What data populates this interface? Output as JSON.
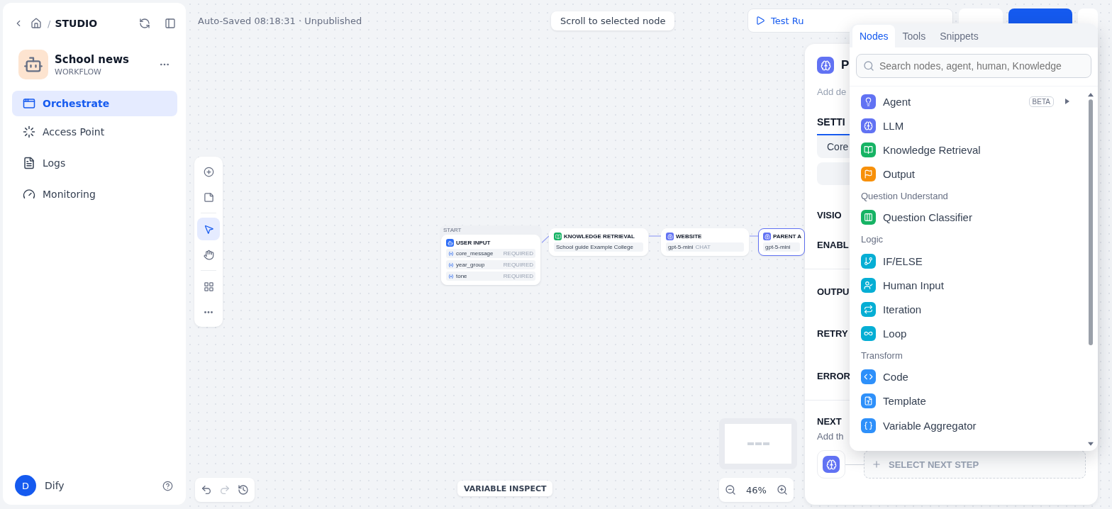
{
  "sidebar": {
    "separator": "/",
    "breadcrumb": "STUDIO",
    "app": {
      "name": "School news",
      "type": "WORKFLOW"
    },
    "nav": [
      {
        "label": "Orchestrate",
        "selected": true
      },
      {
        "label": "Access Point",
        "selected": false
      },
      {
        "label": "Logs",
        "selected": false
      },
      {
        "label": "Monitoring",
        "selected": false
      }
    ],
    "user": {
      "initial": "D",
      "name": "Dify"
    }
  },
  "header": {
    "status": "Auto-Saved 08:18:31 · Unpublished",
    "scroll_hint": "Scroll to selected node",
    "test_run": "Test Ru"
  },
  "canvas": {
    "tools": [
      {
        "selected": false
      },
      {
        "selected": false
      },
      {
        "selected": true
      },
      {
        "selected": false
      },
      {
        "selected": false
      },
      {
        "selected": false
      }
    ],
    "nodes": [
      {
        "kind": "start",
        "label": "START",
        "title": "USER INPUT",
        "variables": [
          {
            "name": "core_message",
            "tag": "REQUIRED"
          },
          {
            "name": "year_group",
            "tag": "REQUIRED"
          },
          {
            "name": "tone",
            "tag": "REQUIRED"
          }
        ]
      },
      {
        "kind": "knowledge",
        "title": "KNOWLEDGE RETRIEVAL",
        "dataset": "School guide Example College"
      },
      {
        "kind": "llm",
        "title": "WEBSITE",
        "model": "gpt-5-mini",
        "tag": "CHAT",
        "selected": false
      },
      {
        "kind": "llm",
        "title": "PARENT A",
        "model": "gpt-5-mini",
        "selected": true
      }
    ],
    "variable_inspect": "VARIABLE INSPECT",
    "zoom": "46%"
  },
  "panel": {
    "title": "P",
    "description": "Add de",
    "tab": "SETTI",
    "chip": "Core",
    "sections": [
      "VISIO",
      "ENABL",
      "OUTPU",
      "RETRY",
      "ERROR"
    ],
    "next_step": {
      "title": "NEXT",
      "hint": "Add th",
      "button": "SELECT NEXT STEP"
    }
  },
  "node_picker": {
    "tabs": [
      {
        "label": "Nodes",
        "selected": true
      },
      {
        "label": "Tools",
        "selected": false
      },
      {
        "label": "Snippets",
        "selected": false
      }
    ],
    "placeholder": "Search nodes, agent, human, Knowledge",
    "items": [
      {
        "kind": "item",
        "label": "Agent",
        "badge": "BETA",
        "color": "#6172f3"
      },
      {
        "kind": "item",
        "label": "LLM",
        "color": "#6172f3"
      },
      {
        "kind": "item",
        "label": "Knowledge Retrieval",
        "color": "#16b364"
      },
      {
        "kind": "item",
        "label": "Output",
        "color": "#f79009"
      },
      {
        "kind": "section",
        "label": "Question Understand"
      },
      {
        "kind": "item",
        "label": "Question Classifier",
        "color": "#16b364"
      },
      {
        "kind": "section",
        "label": "Logic"
      },
      {
        "kind": "item",
        "label": "IF/ELSE",
        "color": "#06aed4"
      },
      {
        "kind": "item",
        "label": "Human Input",
        "color": "#06aed4"
      },
      {
        "kind": "item",
        "label": "Iteration",
        "color": "#06aed4"
      },
      {
        "kind": "item",
        "label": "Loop",
        "color": "#06aed4"
      },
      {
        "kind": "section",
        "label": "Transform"
      },
      {
        "kind": "item",
        "label": "Code",
        "color": "#2e90fa"
      },
      {
        "kind": "item",
        "label": "Template",
        "color": "#2e90fa"
      },
      {
        "kind": "item",
        "label": "Variable Aggregator",
        "color": "#2e90fa"
      }
    ]
  }
}
